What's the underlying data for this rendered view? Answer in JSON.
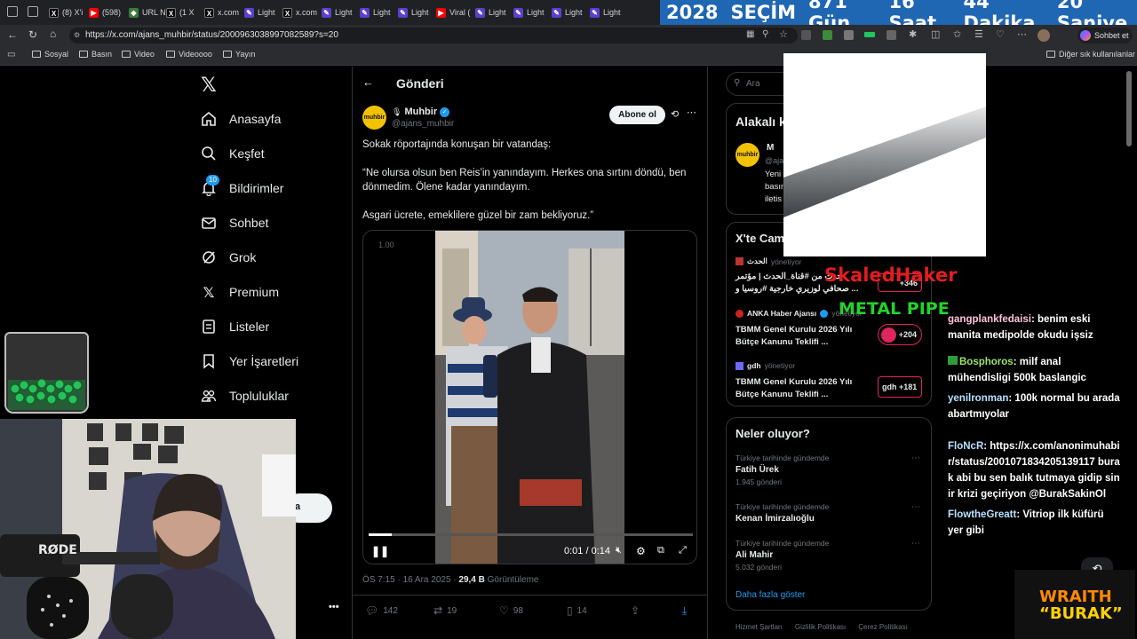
{
  "browser": {
    "tabs": [
      {
        "icon": "x-icon",
        "title": "(8) X'i"
      },
      {
        "icon": "youtube-icon",
        "title": "(598)"
      },
      {
        "icon": "shield-icon",
        "title": "URL N"
      },
      {
        "icon": "x-icon",
        "title": "(1 X"
      },
      {
        "icon": "x-icon",
        "title": "x.com"
      },
      {
        "icon": "pen-icon",
        "title": "Light"
      },
      {
        "icon": "x-icon",
        "title": "x.com"
      },
      {
        "icon": "pen-icon",
        "title": "Light"
      },
      {
        "icon": "pen-icon",
        "title": "Light"
      },
      {
        "icon": "pen-icon",
        "title": "Light"
      },
      {
        "icon": "youtube-icon",
        "title": "Viral ("
      },
      {
        "icon": "pen-icon",
        "title": "Light"
      },
      {
        "icon": "pen-icon",
        "title": "Light"
      },
      {
        "icon": "pen-icon",
        "title": "Light"
      },
      {
        "icon": "pen-icon",
        "title": "Light"
      }
    ],
    "countdown": [
      "2028",
      "SEÇİM",
      "871 Gün",
      "16 Saat",
      "44 Dakika",
      "20 Saniye"
    ],
    "url": "https://x.com/ajans_muhbir/status/2000963038997082589?s=20",
    "chat_button": "Sohbet et",
    "bookmarks": [
      "Sosyal",
      "Basın",
      "Video",
      "Videoooo",
      "Yayın"
    ],
    "other_bookmarks": "Diğer sık kullanılanlar"
  },
  "sidebar": {
    "items": [
      {
        "icon": "home-icon",
        "label": "Anasayfa"
      },
      {
        "icon": "search-icon",
        "label": "Keşfet"
      },
      {
        "icon": "bell-icon",
        "label": "Bildirimler",
        "badge": "10"
      },
      {
        "icon": "mail-icon",
        "label": "Sohbet"
      },
      {
        "icon": "grok-icon",
        "label": "Grok"
      },
      {
        "icon": "x-icon",
        "label": "Premium"
      },
      {
        "icon": "list-icon",
        "label": "Listeler"
      },
      {
        "icon": "bookmark-icon",
        "label": "Yer İşaretleri"
      },
      {
        "icon": "people-icon",
        "label": "Topluluklar"
      }
    ],
    "post_button_partial": "a",
    "more": "•••"
  },
  "post": {
    "header": "Gönderi",
    "author_name": "Muhbir",
    "author_handle": "@ajans_muhbir",
    "avatar_text": "muhbir",
    "subscribe": "Abone ol",
    "line1": "Sokak röportajında konuşan bir vatandaş:",
    "line2": "“Ne olursa olsun ben Reis’in yanındayım. Herkes ona sırtını döndü, ben dönmedim. Ölene kadar yanındayım.",
    "line3": "Asgari ücrete, emeklilere güzel bir zam bekliyoruz.”",
    "video_speed": "1.00",
    "video_time": "0:01 / 0:14",
    "video_progress": 0.07,
    "timestamp": "ÖS 7:15 · 16 Ara 2025 · ",
    "views_count": "29,4 B",
    "views_label": " Görüntüleme",
    "actions": {
      "replies": "142",
      "reposts": "19",
      "likes": "98",
      "bookmarks": "14"
    }
  },
  "right": {
    "search_placeholder": "Ara",
    "related_title": "Alakalı k",
    "related_account": {
      "name": "M",
      "handle": "@aja",
      "bio": [
        "Yeni",
        "basın",
        "iletis"
      ]
    },
    "xcam_title": "X'te Cam",
    "streams": [
      {
        "name": "الحدث",
        "status": "yönetiyor",
        "title": "حدث من #قناة_الحدث | مؤتمر صحافي لوزيري خارجية #روسيا و ...",
        "count": "+346"
      },
      {
        "name": "ANKA Haber Ajansı",
        "status": "yönetiyor",
        "title": "TBMM Genel Kurulu 2026 Yılı Bütçe Kanunu Teklifi ...",
        "count": "+204"
      },
      {
        "name": "gdh",
        "status": "yönetiyor",
        "title": "TBMM Genel Kurulu 2026 Yılı Bütçe Kanunu Teklifi ...",
        "count": "+181",
        "avatar": "gdh"
      }
    ],
    "whats_happening": "Neler oluyor?",
    "trends": [
      {
        "meta": "Türkiye tarihinde gündemde",
        "title": "Fatih Ürek",
        "count": "1.945 gönderi"
      },
      {
        "meta": "Türkiye tarihinde gündemde",
        "title": "Kenan İmirzalıoğlu",
        "count": ""
      },
      {
        "meta": "Türkiye tarihinde gündemde",
        "title": "Ali Mahir",
        "count": "5.032 gönderi"
      }
    ],
    "show_more": "Daha fazla göster",
    "footer": [
      "Hizmet Şartları",
      "Gizlilik Politikası",
      "Çerez Politikası"
    ]
  },
  "overlay": {
    "skaled": "SkaledHaker",
    "metal": "METAL PIPE",
    "chat": [
      {
        "user": "gangplankfedaisi",
        "msg": "benim eski manita medipolde okudu işsiz",
        "color": "#ffc1dc"
      },
      {
        "user": "Bosphoros",
        "msg": "milf anal mühendisligi 500k baslangic",
        "color": "#9be36b"
      },
      {
        "user": "yenilronman",
        "msg": "100k normal bu arada abartmıyolar",
        "color": "#b8e0ff"
      },
      {
        "user": "FloNcR",
        "msg": "https://x.com/anonimuhabir/status/2001071834205139117 burak abi bu sen balık tutmaya gidip sinir krizi geçiriyon @BurakSakinOl",
        "color": "#b8e0ff"
      },
      {
        "user": "FlowtheGreatt",
        "msg": "Vitriop ilk küfürü yer gibi",
        "color": "#b8e0ff"
      }
    ],
    "logo_line1": "WRAITH",
    "logo_line2": "“BURAK”",
    "mic_brand": "RØDE"
  }
}
